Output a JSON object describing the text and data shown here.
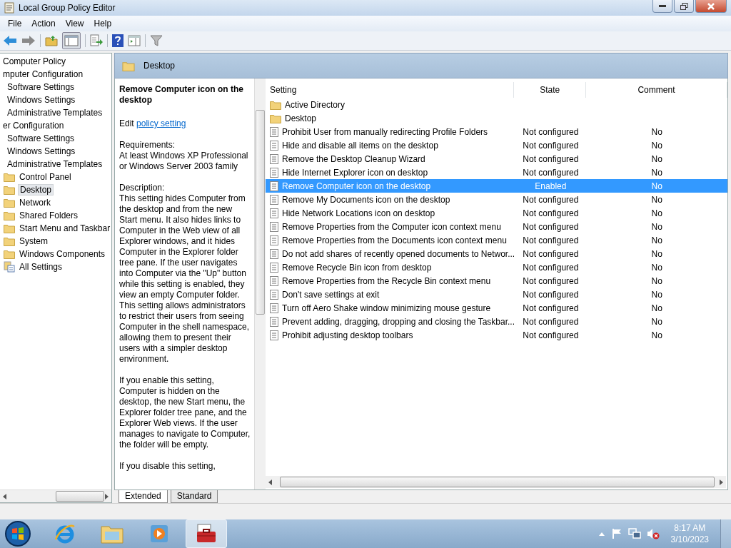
{
  "window": {
    "title": "Local Group Policy Editor"
  },
  "menu": [
    "File",
    "Action",
    "View",
    "Help"
  ],
  "tree": [
    {
      "label": "Computer Policy",
      "selected": false,
      "children": [
        {
          "label": "mputer Configuration",
          "selected": false,
          "children": [
            {
              "label": "Software Settings",
              "selected": false
            },
            {
              "label": "Windows Settings",
              "selected": false
            },
            {
              "label": "Administrative Templates",
              "selected": false
            }
          ]
        },
        {
          "label": "er Configuration",
          "selected": false,
          "children": [
            {
              "label": "Software Settings",
              "selected": false
            },
            {
              "label": "Windows Settings",
              "selected": false
            },
            {
              "label": "Administrative Templates",
              "selected": false,
              "children": [
                {
                  "label": "Control Panel",
                  "selected": false,
                  "kind": "folder"
                },
                {
                  "label": "Desktop",
                  "selected": true,
                  "kind": "folder"
                },
                {
                  "label": "Network",
                  "selected": false,
                  "kind": "folder"
                },
                {
                  "label": "Shared Folders",
                  "selected": false,
                  "kind": "folder"
                },
                {
                  "label": "Start Menu and Taskbar",
                  "selected": false,
                  "kind": "folder"
                },
                {
                  "label": "System",
                  "selected": false,
                  "kind": "folder"
                },
                {
                  "label": "Windows Components",
                  "selected": false,
                  "kind": "folder"
                },
                {
                  "label": "All Settings",
                  "selected": false,
                  "kind": "settings"
                }
              ]
            }
          ]
        }
      ]
    }
  ],
  "header": {
    "title": "Desktop"
  },
  "description": {
    "title": "Remove Computer icon on the desktop",
    "edit_prefix": "Edit",
    "edit_link": "policy setting",
    "paragraphs": [
      "Requirements:\nAt least Windows XP Professional or Windows Server 2003 family",
      "Description:\nThis setting hides Computer from the desktop and from the new Start menu. It also hides links to Computer in the Web view of all Explorer windows, and it hides Computer in the Explorer folder tree pane. If the user navigates into Computer via the \"Up\" button while this setting is enabled, they view an empty Computer folder. This setting allows administrators to restrict their users from seeing Computer in the shell namespace, allowing them to present their users with a simpler desktop environment.",
      "If you enable this setting, Computer is hidden on the desktop, the new Start menu, the Explorer folder tree pane, and the Explorer Web views. If the user manages to navigate to Computer, the folder will be empty.",
      "If you disable this setting,"
    ]
  },
  "columns": [
    "Setting",
    "State",
    "Comment"
  ],
  "settings": [
    {
      "name": "Active Directory",
      "kind": "folder",
      "selected": false
    },
    {
      "name": "Desktop",
      "kind": "folder",
      "selected": false
    },
    {
      "name": "Prohibit User from manually redirecting Profile Folders",
      "kind": "policy",
      "state": "Not configured",
      "comment": "No",
      "selected": false
    },
    {
      "name": "Hide and disable all items on the desktop",
      "kind": "policy",
      "state": "Not configured",
      "comment": "No",
      "selected": false
    },
    {
      "name": "Remove the Desktop Cleanup Wizard",
      "kind": "policy",
      "state": "Not configured",
      "comment": "No",
      "selected": false
    },
    {
      "name": "Hide Internet Explorer icon on desktop",
      "kind": "policy",
      "state": "Not configured",
      "comment": "No",
      "selected": false
    },
    {
      "name": "Remove Computer icon on the desktop",
      "kind": "policy",
      "state": "Enabled",
      "comment": "No",
      "selected": true
    },
    {
      "name": "Remove My Documents icon on the desktop",
      "kind": "policy",
      "state": "Not configured",
      "comment": "No",
      "selected": false
    },
    {
      "name": "Hide Network Locations icon on desktop",
      "kind": "policy",
      "state": "Not configured",
      "comment": "No",
      "selected": false
    },
    {
      "name": "Remove Properties from the Computer icon context menu",
      "kind": "policy",
      "state": "Not configured",
      "comment": "No",
      "selected": false
    },
    {
      "name": "Remove Properties from the Documents icon context menu",
      "kind": "policy",
      "state": "Not configured",
      "comment": "No",
      "selected": false
    },
    {
      "name": "Do not add shares of recently opened documents to Networ...",
      "kind": "policy",
      "state": "Not configured",
      "comment": "No",
      "selected": false
    },
    {
      "name": "Remove Recycle Bin icon from desktop",
      "kind": "policy",
      "state": "Not configured",
      "comment": "No",
      "selected": false
    },
    {
      "name": "Remove Properties from the Recycle Bin context menu",
      "kind": "policy",
      "state": "Not configured",
      "comment": "No",
      "selected": false
    },
    {
      "name": "Don't save settings at exit",
      "kind": "policy",
      "state": "Not configured",
      "comment": "No",
      "selected": false
    },
    {
      "name": "Turn off Aero Shake window minimizing mouse gesture",
      "kind": "policy",
      "state": "Not configured",
      "comment": "No",
      "selected": false
    },
    {
      "name": "Prevent adding, dragging, dropping and closing the Taskbar...",
      "kind": "policy",
      "state": "Not configured",
      "comment": "No",
      "selected": false
    },
    {
      "name": "Prohibit adjusting desktop toolbars",
      "kind": "policy",
      "state": "Not configured",
      "comment": "No",
      "selected": false
    }
  ],
  "view_tabs": [
    {
      "label": "Extended",
      "selected": true
    },
    {
      "label": "Standard",
      "selected": false
    }
  ],
  "taskbar": {
    "items": [
      {
        "kind": "ie",
        "selected": false
      },
      {
        "kind": "explorer",
        "selected": false
      },
      {
        "kind": "media",
        "selected": false
      },
      {
        "kind": "gpedit",
        "selected": true
      }
    ],
    "time": "8:17 AM",
    "date": "3/10/2023"
  }
}
